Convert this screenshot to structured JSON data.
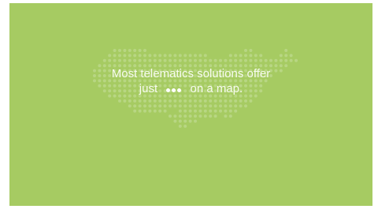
{
  "colors": {
    "background": "#a6cb62",
    "text": "#f7fbef",
    "map_dot": "#b8d683",
    "dot_indicator": "#ffffff"
  },
  "hero": {
    "line1": "Most telematics solutions offer",
    "line2_before": "just",
    "line2_after": "on a map."
  },
  "icons": {
    "dot_indicator": "three-dots-icon",
    "map": "usa-dot-map"
  }
}
